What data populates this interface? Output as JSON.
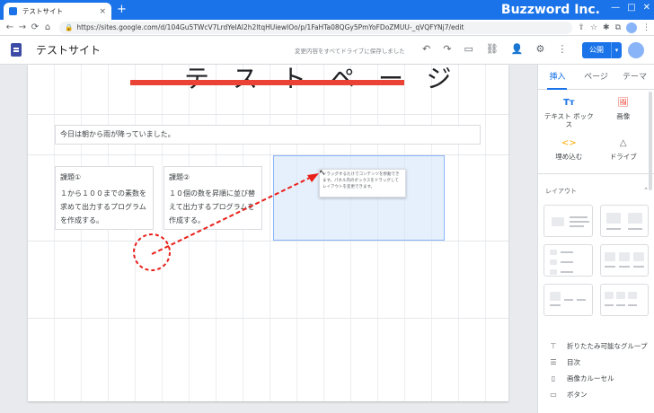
{
  "browser": {
    "tab_title": "テストサイト",
    "tab_close": "×",
    "new_tab": "+",
    "brand": "Buzzword Inc.",
    "window_controls": [
      "—",
      "□",
      "✕"
    ],
    "url": "https://sites.google.com/d/104Gu5TWcV7LrdYeIAI2h2ltqHUiewIOo/p/1FaHTa08QGy5PmYoFDoZMUU-_qVQFYNj7/edit",
    "nav": [
      "←",
      "→",
      "⟳",
      "⌂"
    ]
  },
  "sites_header": {
    "site_name": "テストサイト",
    "save_status": "変更内容をすべてドライブに保存しました",
    "publish_label": "公開",
    "publish_drop": "▾",
    "tool_icons": [
      "↶",
      "↷",
      "▭",
      "⛓",
      "👤",
      "⚙",
      "⋮"
    ]
  },
  "page": {
    "heading_fragment": "テストページ",
    "text_main": "今日は朝から雨が降っていました。",
    "task1_title": "課題①",
    "task1_body": "１から１００までの素数を求めて出力するプログラムを作成する。",
    "task2_title": "課題②",
    "task2_body": "１０個の数を昇順に並び替えて出力するプログラムを作成する。",
    "tooltip_text": "ドラッグするだけでコンテンツを移動できます。パネル内のボックスをドラッグしてレイアウトを変更できます。"
  },
  "panel": {
    "tabs": [
      "挿入",
      "ページ",
      "テーマ"
    ],
    "insert_items": [
      {
        "label": "テキスト ボックス",
        "icon": "Tт"
      },
      {
        "label": "画像",
        "icon": "🖼"
      },
      {
        "label": "埋め込む",
        "icon": "<>"
      },
      {
        "label": "ドライブ",
        "icon": "△"
      }
    ],
    "layout_label": "レイアウト",
    "layout_chevron": "⌃",
    "components": [
      {
        "label": "折りたたみ可能なグループ",
        "icon": "⊤"
      },
      {
        "label": "目次",
        "icon": "☰"
      },
      {
        "label": "画像カルーセル",
        "icon": "▯"
      },
      {
        "label": "ボタン",
        "icon": "▭"
      }
    ]
  },
  "colors": {
    "accent": "#1a73e8",
    "annotation_red": "#e8201a",
    "selection_fill": "#d2e3fc"
  }
}
